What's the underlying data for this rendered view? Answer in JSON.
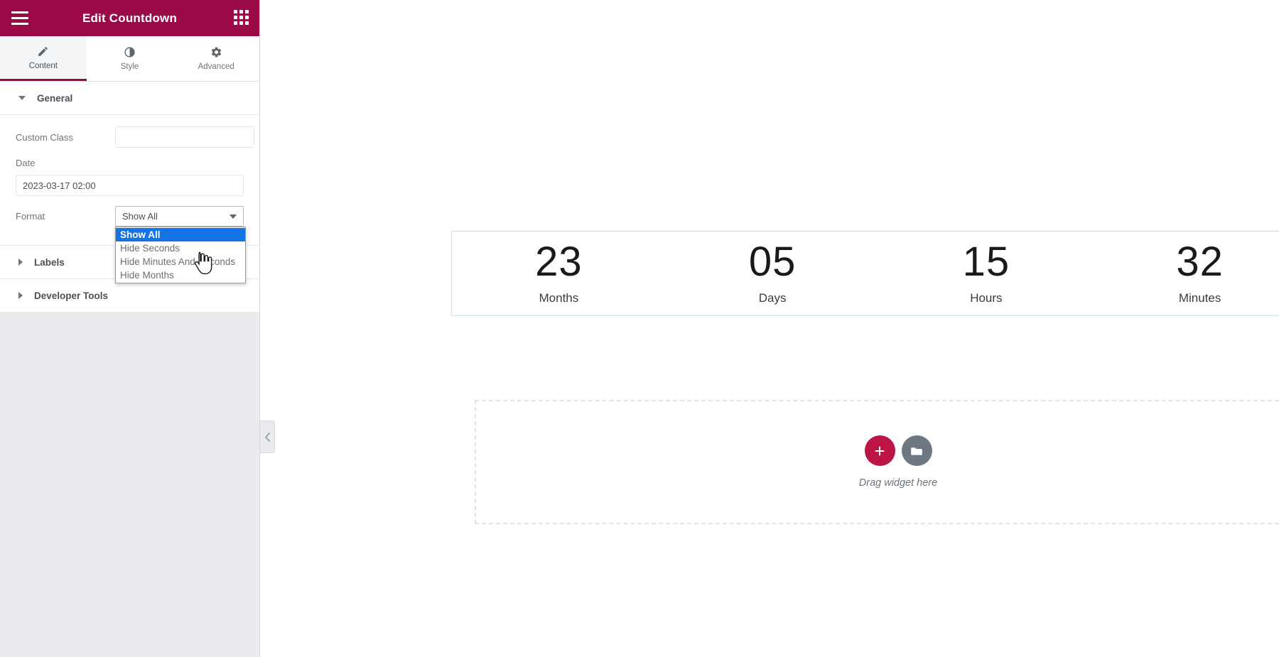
{
  "panel": {
    "title": "Edit Countdown",
    "menu_icon": "hamburger-menu-icon",
    "apps_icon": "apps-grid-icon",
    "tabs": [
      {
        "label": "Content",
        "icon": "pencil-icon",
        "active": true
      },
      {
        "label": "Style",
        "icon": "contrast-icon",
        "active": false
      },
      {
        "label": "Advanced",
        "icon": "gear-icon",
        "active": false
      }
    ],
    "sections": [
      {
        "label": "General",
        "expanded": true
      },
      {
        "label": "Labels",
        "expanded": false
      },
      {
        "label": "Developer Tools",
        "expanded": false
      }
    ],
    "general": {
      "custom_class": {
        "label": "Custom Class",
        "value": "",
        "placeholder": ""
      },
      "date": {
        "label": "Date",
        "value": "2023-03-17 02:00",
        "placeholder": ""
      },
      "format": {
        "label": "Format",
        "value": "Show All",
        "open": true,
        "options": [
          "Show All",
          "Hide Seconds",
          "Hide Minutes And Seconds",
          "Hide Months"
        ]
      }
    },
    "collapse_icon": "chevron-left-icon"
  },
  "canvas": {
    "countdown": [
      {
        "digits": "23",
        "label": "Months"
      },
      {
        "digits": "05",
        "label": "Days"
      },
      {
        "digits": "15",
        "label": "Hours"
      },
      {
        "digits": "32",
        "label": "Minutes"
      }
    ],
    "dropzone": {
      "text": "Drag widget here",
      "add_icon": "plus-icon",
      "folder_icon": "folder-icon"
    }
  },
  "colors": {
    "brand": "#9b0a46",
    "accent_button": "#bc1444",
    "select_highlight": "#1473e6",
    "widget_border": "#cfe3ee",
    "panel_bg": "#e9ebee"
  }
}
